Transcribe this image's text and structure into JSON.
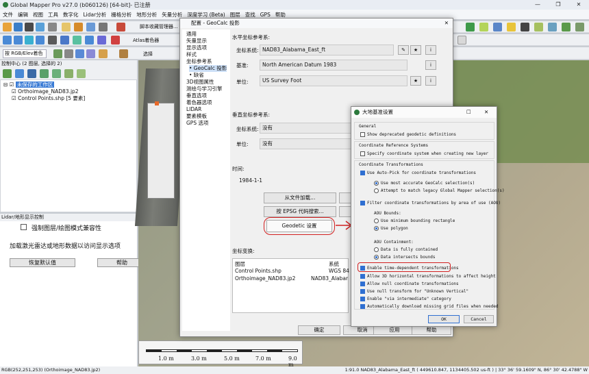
{
  "window": {
    "title": "Global Mapper Pro v27.0 (b060126) [64-bit]- 已注册"
  },
  "menu": [
    "文件",
    "编辑",
    "视图",
    "工具",
    "数字化",
    "Lidar分析",
    "栅格分析",
    "地形分析",
    "矢量分析",
    "深度学习 (Beta)",
    "图层",
    "查找",
    "GPS",
    "帮助"
  ],
  "toolbar": {
    "script_label": "脚本收藏管理器...",
    "atlas_label": "Atlas着色器",
    "select_label": "选择",
    "rgb_select": "按 RGB/Elev着色"
  },
  "control_center": {
    "title": "控制中心 (2 图层, 选择的 2)",
    "workspace": "未保存的工作区",
    "layers": [
      "Orthoimage_NAD83.jp2",
      "Control Points.shp [5 要素]"
    ]
  },
  "lidar_panel": {
    "title": "Lidar/地形显示控制",
    "checkbox": "强制图层/绘图模式兼容性",
    "hint": "加载激光雷达或地形数据以访问显示选项",
    "reset": "恢复默认值",
    "help": "帮助"
  },
  "config": {
    "title": "配置 - GeoCalc 投影",
    "nav": [
      "通用",
      "矢量显示",
      "显示选项",
      "样式",
      "坐标参考系",
      "• GeoCalc 投影",
      "• 缺省",
      "3D视图属性",
      "测绘与学习引擎",
      "垂直选项",
      "着色器选项",
      "LIDAR",
      "要素模板",
      "GPS 选项"
    ],
    "horiz_section": "水平坐标参考系:",
    "coord_label": "坐标系统:",
    "coord_value": "NAD83_Alabama_East_ft",
    "datum_label": "基准:",
    "datum_value": "North American Datum 1983",
    "unit_label": "单位:",
    "unit_value": "US Survey Foot",
    "vert_section": "垂直坐标参考系:",
    "vcoord_label": "坐标系统:",
    "vcoord_value": "没有",
    "vunit_label": "单位:",
    "vunit_value": "没有",
    "time_label": "时间:",
    "time_value": "1984-1-1",
    "load_file": "从文件加载...",
    "epsg": "按 EPSG 代码搜索...",
    "geodetic": "Geodetic 设置",
    "xform_label": "坐标变换:",
    "xform_cols": [
      "图层",
      "系统"
    ],
    "xform_rows": [
      [
        "Control Points.shp",
        "WGS 84"
      ],
      [
        "Orthoimage_NAD83.jp2",
        "NAD83_Alabama"
      ]
    ],
    "ok": "确定",
    "cancel": "取消",
    "apply": "应用",
    "help": "帮助"
  },
  "datum_dialog": {
    "title": "大地基准设置",
    "general": "General",
    "deprecated": "Show deprecated geodetic definitions",
    "crs_section": "Coordinate Reference Systems",
    "specify_crs": "Specify coordinate system when creating new layer",
    "ct_section": "Coordinate Transformations",
    "autopick": "Use Auto-Pick for coordinate transformations",
    "most_accurate": "Use most accurate GeoCalc selection(s)",
    "legacy": "Attempt to match legacy Global Mapper selection(s)",
    "filter_aou": "Filter coordinate transformations by area of use (AOU)",
    "aou_bounds": "AOU Bounds:",
    "min_rect": "Use minimum bounding rectangle",
    "polygon": "Use polygon",
    "aou_contain": "AOU Containment:",
    "fully_contained": "Data is fully contained",
    "intersects": "Data intersects bounds",
    "time_dep": "Enable time-dependent transformations",
    "allow_3d": "Allow 3D horizontal transformations to affect height",
    "allow_null": "Allow null coordinate transformations",
    "null_vertical": "Use null transform for \"Unknown Vertical\"",
    "via_intermediate": "Enable \"via intermediate\" category",
    "auto_download": "Automatically download missing grid files when needed",
    "ok": "OK",
    "cancel": "Cancel"
  },
  "scale": {
    "labels": [
      "1.0 m",
      "3.0 m",
      "5.0 m",
      "7.0 m",
      "9.0 m"
    ]
  },
  "status": {
    "left": "RGB(252,251,253) (Orthoimage_NAD83.jp2)",
    "right": "1:91.0  NAD83_Alabama_East_ft ( 449610.847, 1134405.502 us-ft ) | 33° 36' 59.1609\" N, 86° 30' 42.4788\" W"
  }
}
